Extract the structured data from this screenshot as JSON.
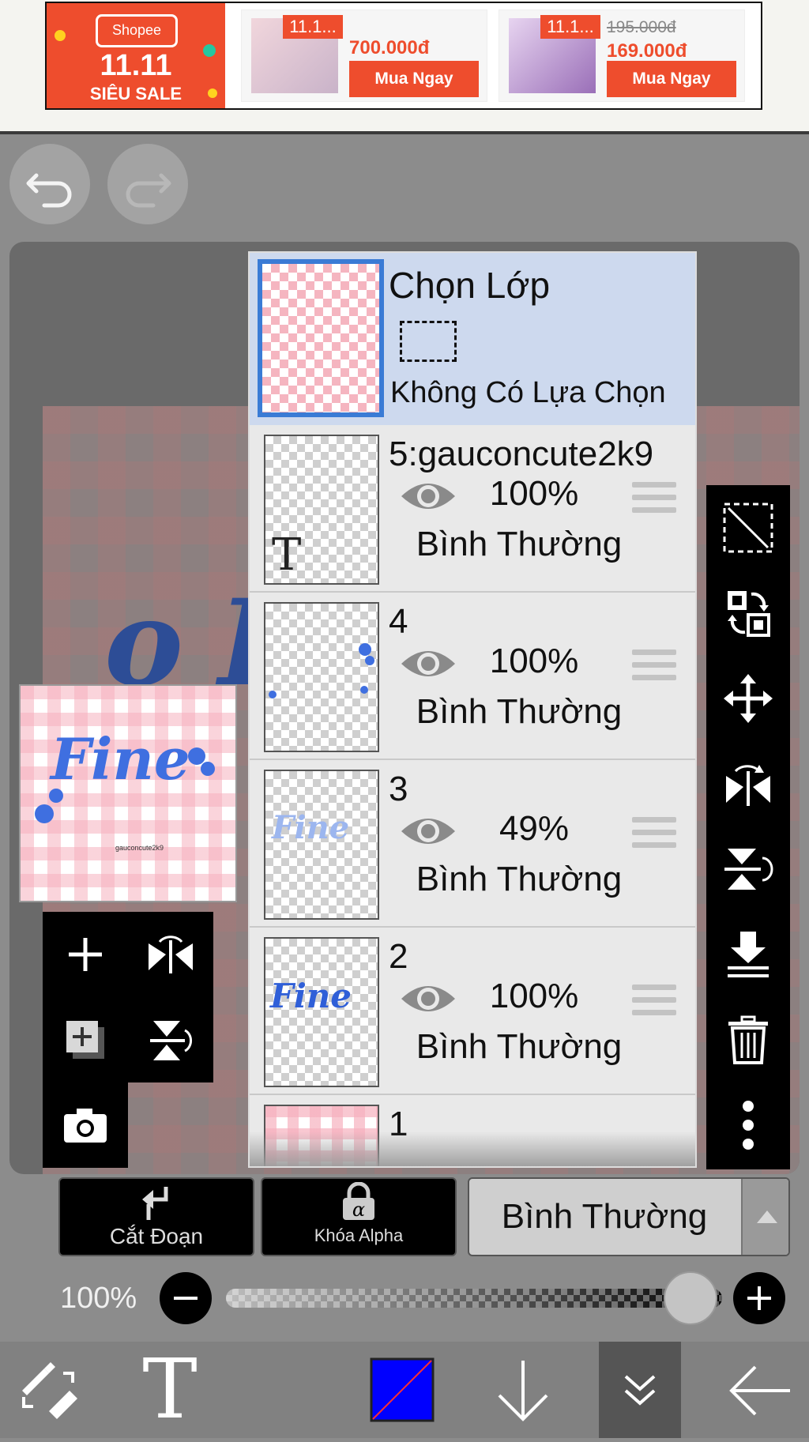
{
  "ad": {
    "brand": "Shopee",
    "event": "11.11",
    "sale_text": "SIÊU SALE",
    "products": [
      {
        "tag": "11.1...",
        "price": "700.000đ",
        "old_price": "",
        "button": "Mua Ngay"
      },
      {
        "tag": "11.1...",
        "price": "169.000đ",
        "old_price": "195.000đ",
        "button": "Mua Ngay"
      }
    ]
  },
  "top": {
    "undo_icon": "undo-icon",
    "redo_icon": "redo-icon"
  },
  "layers_panel": {
    "selection": {
      "title": "Chọn Lớp",
      "status": "Không Có Lựa Chọn"
    },
    "layers": [
      {
        "name": "5:gauconcute2k9",
        "opacity": "100%",
        "blend": "Bình Thường",
        "thumb_text": "T"
      },
      {
        "name": "4",
        "opacity": "100%",
        "blend": "Bình Thường",
        "thumb_text": ""
      },
      {
        "name": "3",
        "opacity": "49%",
        "blend": "Bình Thường",
        "thumb_text": "Fine"
      },
      {
        "name": "2",
        "opacity": "100%",
        "blend": "Bình Thường",
        "thumb_text": "Fine"
      },
      {
        "name": "1",
        "opacity": "",
        "blend": "",
        "thumb_text": ""
      }
    ]
  },
  "canvas": {
    "thumb_title": "Fine",
    "thumb_caption": "gauconcute2k9"
  },
  "controls": {
    "clipping_label": "Cắt Đoạn",
    "alpha_lock_label": "Khóa Alpha",
    "blend_mode": "Bình Thường",
    "opacity_label": "100%",
    "opacity_value": 1.0
  },
  "colors": {
    "accent_orange": "#ee4d2d",
    "selection_highlight": "#cdd9ee",
    "selected_border": "#3a7bd5",
    "brush_color": "#0000ff"
  }
}
